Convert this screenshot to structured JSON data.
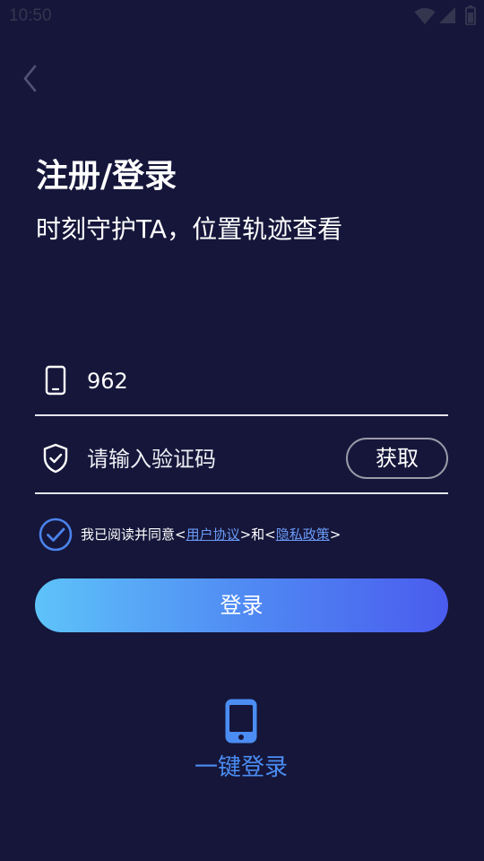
{
  "status_bar": {
    "time": "10:50",
    "icons": [
      "wifi-icon",
      "signal-icon",
      "battery-icon"
    ]
  },
  "header": {
    "back_icon": "chevron-left-icon",
    "title": "注册/登录",
    "subtitle": "时刻守护TA，位置轨迹查看"
  },
  "form": {
    "phone": {
      "icon": "phone-icon",
      "value": "962"
    },
    "code": {
      "icon": "shield-check-icon",
      "placeholder": "请输入验证码",
      "get_code_label": "获取"
    }
  },
  "agreement": {
    "checked": true,
    "icon": "check-circle-icon",
    "prefix": "我已阅读并同意<",
    "user_agreement": "用户协议",
    "middle": ">和<",
    "privacy_policy": "隐私政策",
    "suffix": ">"
  },
  "login_button": {
    "label": "登录"
  },
  "one_click": {
    "icon": "smartphone-icon",
    "label": "一键登录"
  },
  "colors": {
    "background": "#15163a",
    "accent": "#4b8df3",
    "link": "#6b9bf7",
    "checkbox": "#4b82ea",
    "button_gradient_start": "#5ec3f9",
    "button_gradient_end": "#4a5cee"
  }
}
